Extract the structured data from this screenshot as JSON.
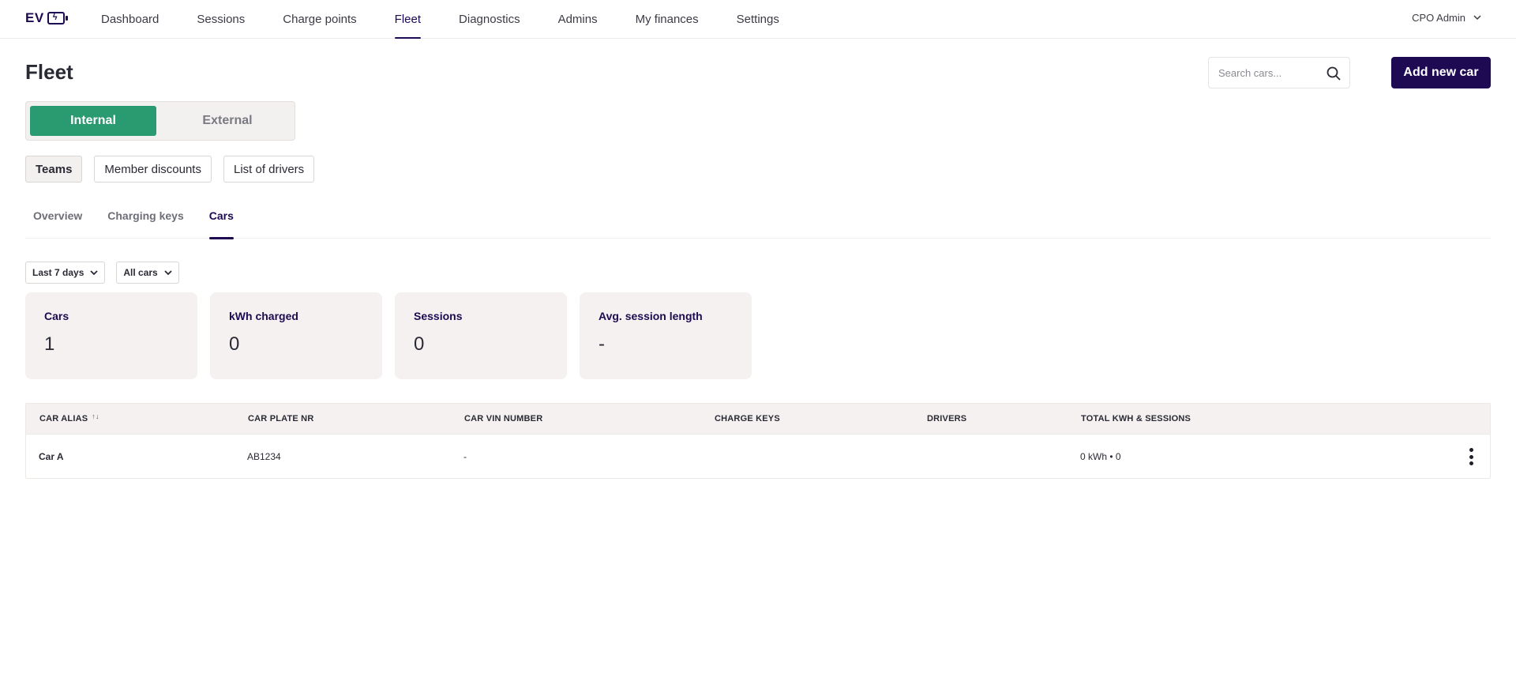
{
  "brand": {
    "logo_text": "EV"
  },
  "nav": {
    "items": [
      {
        "label": "Dashboard"
      },
      {
        "label": "Sessions"
      },
      {
        "label": "Charge points"
      },
      {
        "label": "Fleet"
      },
      {
        "label": "Diagnostics"
      },
      {
        "label": "Admins"
      },
      {
        "label": "My finances"
      },
      {
        "label": "Settings"
      }
    ],
    "active": "Fleet",
    "user": "CPO Admin"
  },
  "header": {
    "title": "Fleet",
    "search_placeholder": "Search cars...",
    "add_button": "Add new car"
  },
  "segment": {
    "internal": "Internal",
    "external": "External",
    "active": "Internal"
  },
  "pills": [
    {
      "label": "Teams"
    },
    {
      "label": "Member discounts"
    },
    {
      "label": "List of drivers"
    }
  ],
  "tabs": [
    {
      "label": "Overview"
    },
    {
      "label": "Charging keys"
    },
    {
      "label": "Cars"
    }
  ],
  "filters": {
    "period": "Last 7 days",
    "cars": "All cars"
  },
  "stats": [
    {
      "label": "Cars",
      "value": "1"
    },
    {
      "label": "kWh charged",
      "value": "0"
    },
    {
      "label": "Sessions",
      "value": "0"
    },
    {
      "label": "Avg. session length",
      "value": "-"
    }
  ],
  "table": {
    "columns": {
      "alias": "CAR ALIAS",
      "plate": "CAR PLATE NR",
      "vin": "CAR VIN NUMBER",
      "keys": "CHARGE KEYS",
      "drivers": "DRIVERS",
      "total": "TOTAL KWH & SESSIONS"
    },
    "rows": [
      {
        "alias": "Car A",
        "plate": "AB1234",
        "vin": "-",
        "keys": "",
        "drivers": "",
        "total": "0 kWh • 0"
      }
    ]
  },
  "colors": {
    "brand": "#1e0a52",
    "accent_green": "#2a9a70",
    "card_bg": "#f4f1f0"
  }
}
